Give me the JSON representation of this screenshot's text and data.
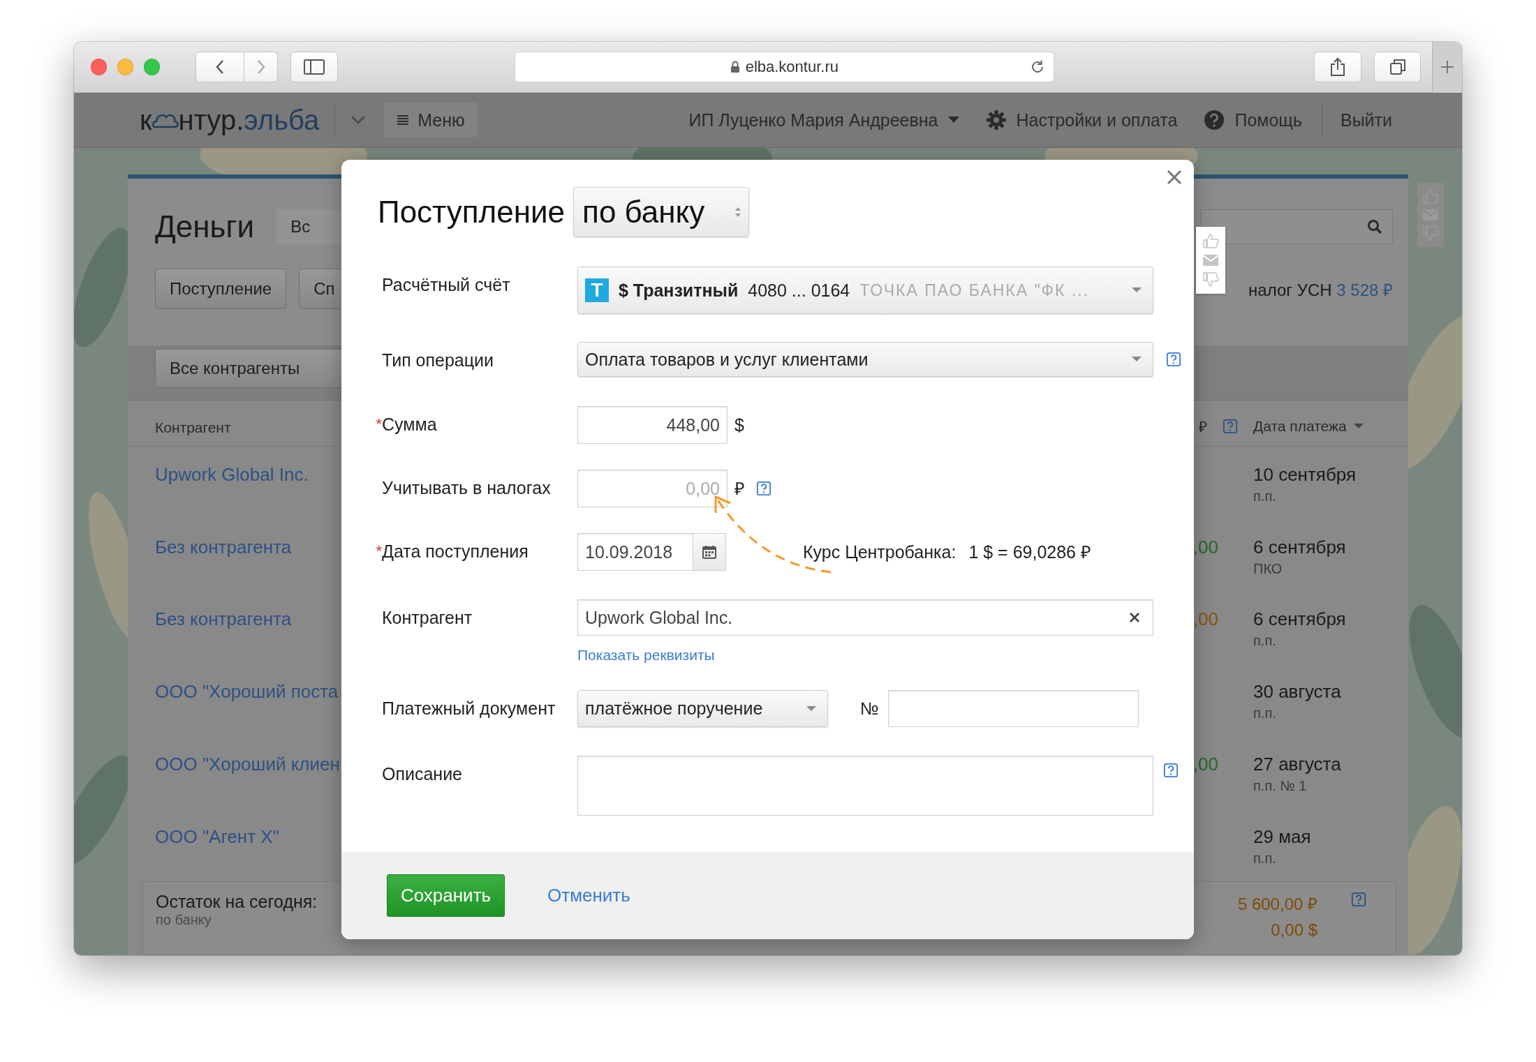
{
  "browser": {
    "url": "elba.kontur.ru"
  },
  "header": {
    "logo": {
      "part_1": "к",
      "part_2": "нтур.",
      "accent": "эльба"
    },
    "menu": "Меню",
    "account": "ИП Луценко Мария Андреевна",
    "settings": "Настройки и оплата",
    "help": "Помощь",
    "logout": "Выйти"
  },
  "page": {
    "title": "Деньги",
    "period_button": "Вс",
    "action_buttons": [
      "Поступление",
      "Сп"
    ],
    "tax_label": "налог УСН",
    "tax_amount": "3 528 ₽",
    "filter": "Все контрагенты",
    "columns": [
      {
        "label": "Контрагент"
      },
      {
        "label": "₽"
      },
      {
        "label": "Дата платежа"
      }
    ],
    "rows": [
      {
        "counterparty": "Upwork Global Inc.",
        "date": "10 сентября",
        "document": "п.п."
      },
      {
        "counterparty": "Без контрагента",
        "amount": ",00",
        "color": "#1f6a26",
        "date": "6 сентября",
        "document": "ПКО"
      },
      {
        "counterparty": "Без контрагента",
        "amount": ",00",
        "color": "#8a520c",
        "date": "6 сентября",
        "document": "п.п."
      },
      {
        "counterparty": "ООО \"Хороший поста",
        "date": "30 августа",
        "document": "п.п."
      },
      {
        "counterparty": "ООО \"Хороший клиен",
        "amount": ",00",
        "color": "#1f6a26",
        "date": "27 августа",
        "document": "п.п. № 1"
      },
      {
        "counterparty": "ООО \"Агент Х\"",
        "date": "29 мая",
        "document": "п.п."
      }
    ],
    "balance": {
      "label": "Остаток на сегодня:",
      "sub": "по банку",
      "rub": "5 600,00 ₽",
      "usd": "0,00 $"
    }
  },
  "modal": {
    "title": "Поступление",
    "mode": "по банку",
    "account": {
      "label": "Расчётный счёт",
      "bank_letter": "Т",
      "name": "$ Транзитный",
      "number": "4080 ... 0164",
      "bank": "ТОЧКА ПАО БАНКА \"ФК ..."
    },
    "operation": {
      "label": "Тип операции",
      "value": "Оплата товаров и услуг клиентами"
    },
    "amount": {
      "label": "Сумма",
      "required_mark": "*",
      "value": "448,00",
      "currency": "$"
    },
    "tax": {
      "label": "Учитывать в налогах",
      "placeholder": "0,00",
      "currency": "₽"
    },
    "date": {
      "label": "Дата поступления",
      "required_mark": "*",
      "value": "10.09.2018",
      "rate_label": "Курс Центробанка:",
      "rate": "1 $ = 69,0286 ₽"
    },
    "counterparty": {
      "label": "Контрагент",
      "value": "Upwork Global Inc.",
      "details_link": "Показать реквизиты"
    },
    "document": {
      "label": "Платежный документ",
      "type": "платёжное поручение",
      "number_label": "№"
    },
    "description": {
      "label": "Описание"
    },
    "save": "Сохранить",
    "cancel": "Отменить"
  }
}
